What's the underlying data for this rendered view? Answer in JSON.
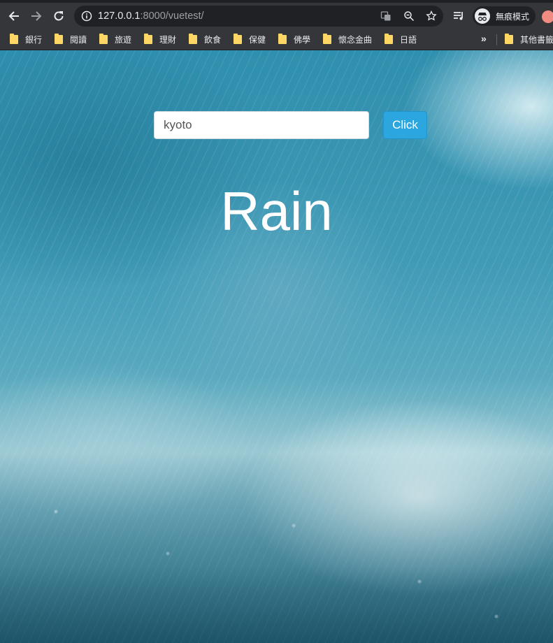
{
  "browser": {
    "url_host": "127.0.0.1",
    "url_rest": ":8000/vuetest/",
    "profile_label": "無痕模式"
  },
  "bookmarks": {
    "items": [
      "銀行",
      "閱讀",
      "旅遊",
      "理財",
      "飲食",
      "保健",
      "佛學",
      "懷念金曲",
      "日語"
    ],
    "overflow_chevron": "»",
    "other": "其他書籤"
  },
  "page": {
    "search_value": "kyoto",
    "button_label": "Click",
    "weather_title": "Rain"
  }
}
